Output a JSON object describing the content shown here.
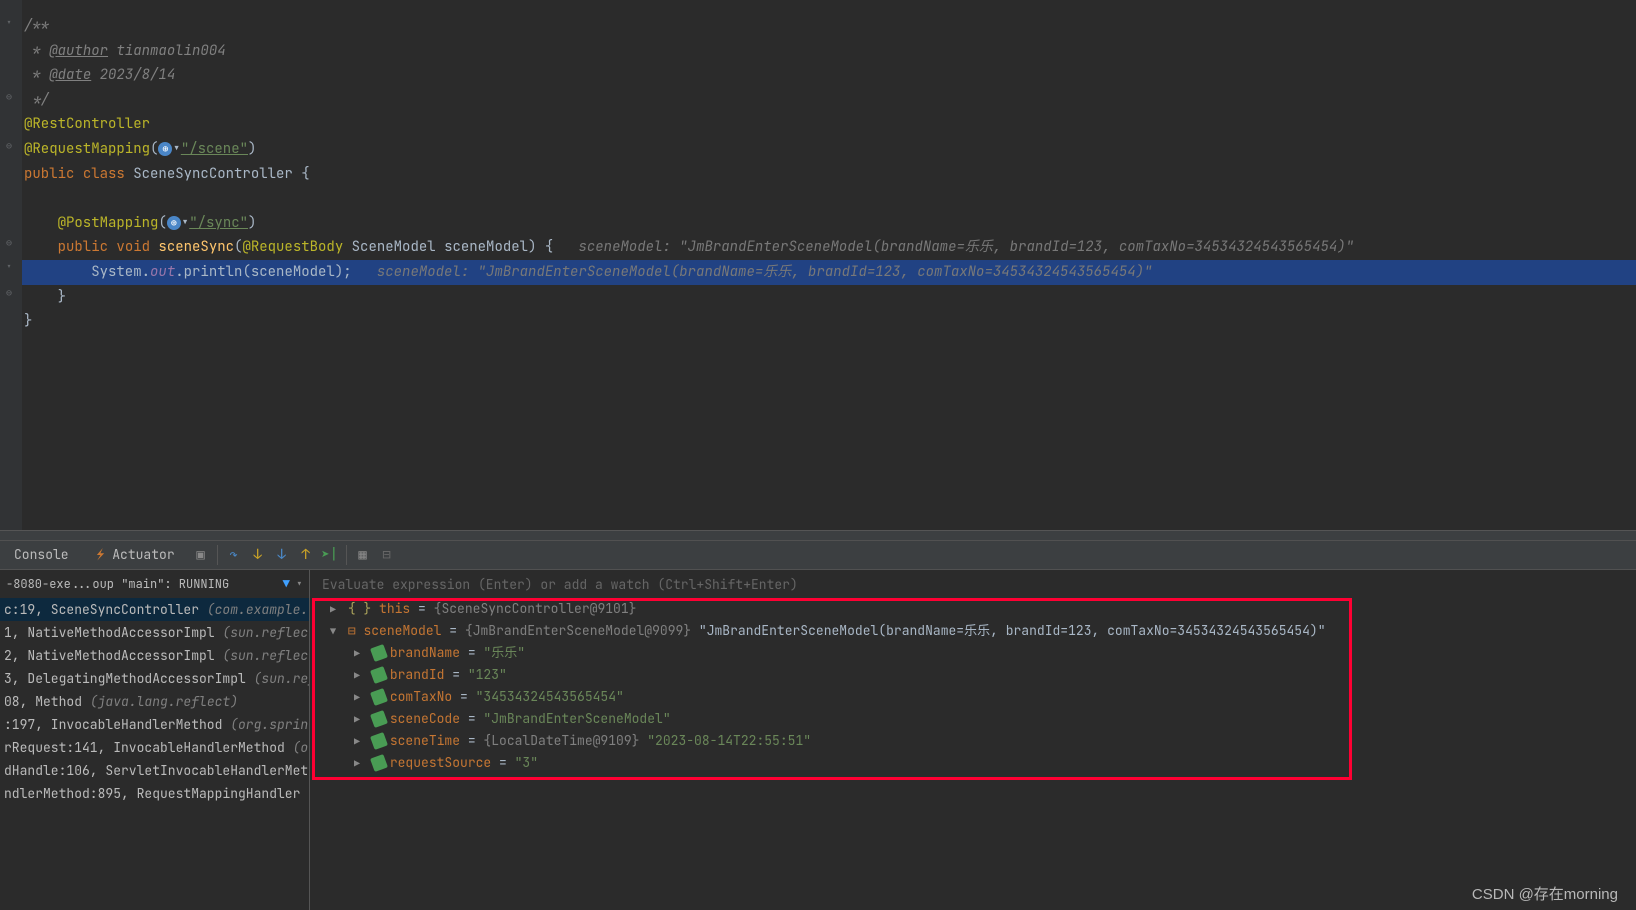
{
  "code": {
    "doc_open": "/**",
    "author_tag": "@author",
    "author_val": " tianmaolin004",
    "date_tag": "@date",
    "date_val": " 2023/8/14",
    "doc_close": " */",
    "anno_rest": "@RestController",
    "anno_reqmap": "@RequestMapping",
    "url_scene": "\"/scene\"",
    "kw_public": "public ",
    "kw_class": "class ",
    "cls_name": "SceneSyncController ",
    "brace_open": "{",
    "anno_post": "@PostMapping",
    "url_sync": "\"/sync\"",
    "kw_void": "void ",
    "m_sceneSync": "sceneSync",
    "anno_body": "@RequestBody",
    "type_model": " SceneModel ",
    "param_model": "sceneModel",
    "hint1": "sceneModel: \"JmBrandEnterSceneModel(brandName=乐乐, brandId=123, comTaxNo=34534324543565454)\"",
    "stmt_system": "System",
    "stmt_out": "out",
    "stmt_println": "println",
    "hint2": "sceneModel: \"JmBrandEnterSceneModel(brandName=乐乐, brandId=123, comTaxNo=34534324543565454)\"",
    "brace_close": "}"
  },
  "toolbar": {
    "console": "Console",
    "actuator": "Actuator"
  },
  "frames": {
    "header": "-8080-exe...oup \"main\": RUNNING",
    "rows": [
      {
        "loc": "c:19, SceneSyncController ",
        "pkg": "(com.example.sp"
      },
      {
        "loc": "1, NativeMethodAccessorImpl ",
        "pkg": "(sun.reflect)"
      },
      {
        "loc": "2, NativeMethodAccessorImpl ",
        "pkg": "(sun.reflect)"
      },
      {
        "loc": "3, DelegatingMethodAccessorImpl ",
        "pkg": "(sun.refle"
      },
      {
        "loc": "08, Method ",
        "pkg": "(java.lang.reflect)"
      },
      {
        "loc": ":197, InvocableHandlerMethod ",
        "pkg": "(org.spring"
      },
      {
        "loc": "rRequest:141, InvocableHandlerMethod ",
        "pkg": "(or"
      },
      {
        "loc": "dHandle:106, ServletInvocableHandlerMet",
        "pkg": ""
      },
      {
        "loc": "ndlerMethod:895, RequestMappingHandler",
        "pkg": ""
      }
    ]
  },
  "vars": {
    "eval_placeholder": "Evaluate expression (Enter) or add a watch (Ctrl+Shift+Enter)",
    "this_line": {
      "name": "this",
      "obj": "{SceneSyncController@9101}"
    },
    "model": {
      "name": "sceneModel",
      "obj": "{JmBrandEnterSceneModel@9099}",
      "tostr": "\"JmBrandEnterSceneModel(brandName=乐乐, brandId=123, comTaxNo=34534324543565454)\""
    },
    "fields": [
      {
        "name": "brandName",
        "val": "\"乐乐\""
      },
      {
        "name": "brandId",
        "val": "\"123\""
      },
      {
        "name": "comTaxNo",
        "val": "\"34534324543565454\""
      },
      {
        "name": "sceneCode",
        "val": "\"JmBrandEnterSceneModel\""
      },
      {
        "name": "sceneTime",
        "obj": "{LocalDateTime@9109}",
        "val": "\"2023-08-14T22:55:51\""
      },
      {
        "name": "requestSource",
        "val": "\"3\""
      }
    ]
  },
  "watermark": "CSDN @存在morning"
}
